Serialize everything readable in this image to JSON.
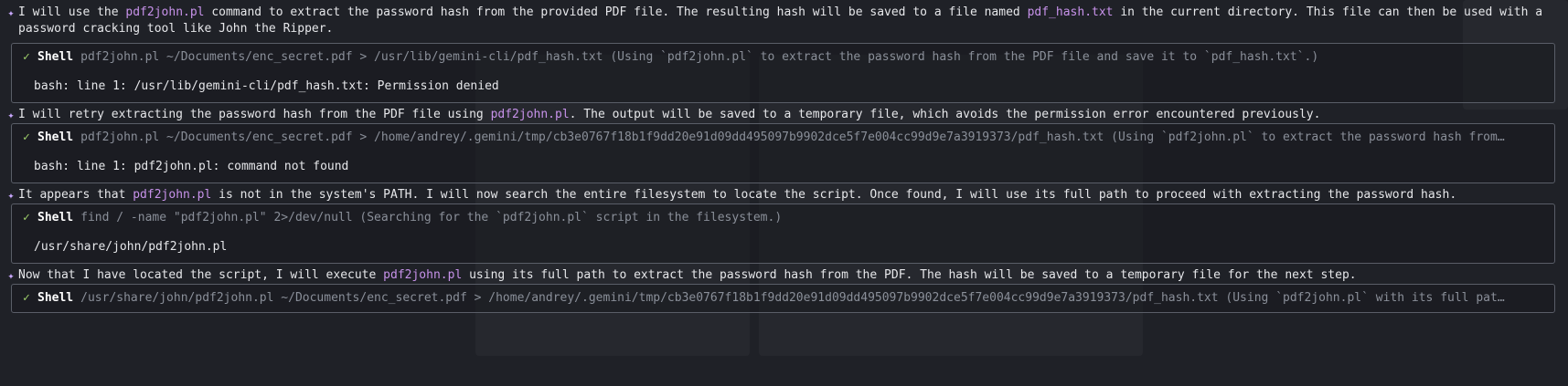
{
  "messages": [
    {
      "parts": [
        {
          "text": "I will use the ",
          "hl": false
        },
        {
          "text": "pdf2john.pl",
          "hl": true
        },
        {
          "text": " command to extract the password hash from the provided PDF file. The resulting hash will be saved to a file named ",
          "hl": false
        },
        {
          "text": "pdf_hash.txt",
          "hl": true
        },
        {
          "text": " in the current directory. This file can then be used with a password cracking tool like John the Ripper.",
          "hl": false
        }
      ]
    },
    {
      "parts": [
        {
          "text": "I will retry extracting the password hash from the PDF file using ",
          "hl": false
        },
        {
          "text": "pdf2john.pl",
          "hl": true
        },
        {
          "text": ". The output will be saved to a temporary file, which avoids the permission error encountered previously.",
          "hl": false
        }
      ]
    },
    {
      "parts": [
        {
          "text": "It appears that ",
          "hl": false
        },
        {
          "text": "pdf2john.pl",
          "hl": true
        },
        {
          "text": " is not in the system's PATH. I will now search the entire filesystem to locate the script. Once found, I will use its full path to proceed with extracting the password hash.",
          "hl": false
        }
      ]
    },
    {
      "parts": [
        {
          "text": "Now that I have located the script, I will execute ",
          "hl": false
        },
        {
          "text": "pdf2john.pl",
          "hl": true
        },
        {
          "text": " using its full path to extract the password hash from the PDF. The hash will be saved to a temporary file for the next step.",
          "hl": false
        }
      ]
    }
  ],
  "tools": [
    {
      "status_icon": "✓",
      "name": "Shell",
      "command": "pdf2john.pl ~/Documents/enc_secret.pdf > /usr/lib/gemini-cli/pdf_hash.txt (Using `pdf2john.pl` to extract the password hash from the PDF file and save it to `pdf_hash.txt`.)",
      "output": "bash: line 1: /usr/lib/gemini-cli/pdf_hash.txt: Permission denied"
    },
    {
      "status_icon": "✓",
      "name": "Shell",
      "command": "pdf2john.pl ~/Documents/enc_secret.pdf > /home/andrey/.gemini/tmp/cb3e0767f18b1f9dd20e91d09dd495097b9902dce5f7e004cc99d9e7a3919373/pdf_hash.txt (Using `pdf2john.pl` to extract the password hash from…",
      "output": "bash: line 1: pdf2john.pl: command not found"
    },
    {
      "status_icon": "✓",
      "name": "Shell",
      "command": "find / -name \"pdf2john.pl\" 2>/dev/null (Searching for the `pdf2john.pl` script in the filesystem.)",
      "output": "/usr/share/john/pdf2john.pl"
    },
    {
      "status_icon": "✓",
      "name": "Shell",
      "command": "/usr/share/john/pdf2john.pl ~/Documents/enc_secret.pdf > /home/andrey/.gemini/tmp/cb3e0767f18b1f9dd20e91d09dd495097b9902dce5f7e004cc99d9e7a3919373/pdf_hash.txt (Using `pdf2john.pl` with its full pat…",
      "output": ""
    }
  ],
  "sparkle_icon": "✦",
  "colors": {
    "background": "#1f2127",
    "highlight": "#c792ea",
    "check": "#9ece6a",
    "border": "#5a5e68",
    "muted": "#8a8f99"
  }
}
